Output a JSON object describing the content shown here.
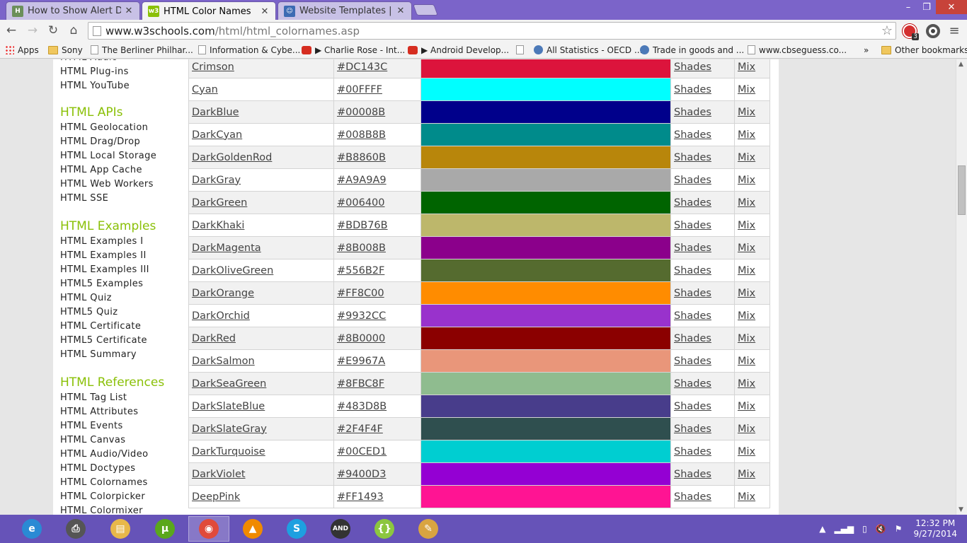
{
  "tabs": [
    {
      "title": "How to Show Alert Dialog",
      "icon": "hackernoon-icon",
      "active": false
    },
    {
      "title": "HTML Color Names",
      "icon": "w3schools-icon",
      "active": true
    },
    {
      "title": "Website Templates | Web",
      "icon": "templates-icon",
      "active": false
    }
  ],
  "window": {
    "minimize": "–",
    "maximize": "❐",
    "close": "✕"
  },
  "toolbar": {
    "url_host": "www.w3schools.com",
    "url_path": "/html/html_colornames.asp",
    "ext_badge": "3"
  },
  "bookmarks": [
    {
      "label": "Apps",
      "icon": "apps-icon"
    },
    {
      "label": "Sony",
      "icon": "folder-icon"
    },
    {
      "label": "The Berliner Philhar...",
      "icon": "page-icon"
    },
    {
      "label": "Information & Cybe...",
      "icon": "page-icon"
    },
    {
      "label": "▶ Charlie Rose - Int...",
      "icon": "youtube-icon"
    },
    {
      "label": "▶ Android Develop...",
      "icon": "youtube-icon"
    },
    {
      "label": "",
      "icon": "page-icon"
    },
    {
      "label": "All Statistics - OECD ...",
      "icon": "globe-icon"
    },
    {
      "label": "Trade in goods and ...",
      "icon": "globe-icon"
    },
    {
      "label": "www.cbseguess.co...",
      "icon": "page-icon"
    },
    {
      "label": "»",
      "icon": ""
    },
    {
      "label": "Other bookmarks",
      "icon": "folder-icon"
    }
  ],
  "sidebar": {
    "cut_top_item": "HTML Audio",
    "group0_items": [
      "HTML Plug-ins",
      "HTML YouTube"
    ],
    "groups": [
      {
        "heading": "HTML APIs",
        "items": [
          "HTML Geolocation",
          "HTML Drag/Drop",
          "HTML Local Storage",
          "HTML App Cache",
          "HTML Web Workers",
          "HTML SSE"
        ]
      },
      {
        "heading": "HTML Examples",
        "items": [
          "HTML Examples I",
          "HTML Examples II",
          "HTML Examples III",
          "HTML5 Examples",
          "HTML Quiz",
          "HTML5 Quiz",
          "HTML Certificate",
          "HTML5 Certificate",
          "HTML Summary"
        ]
      },
      {
        "heading": "HTML References",
        "items": [
          "HTML Tag List",
          "HTML Attributes",
          "HTML Events",
          "HTML Canvas",
          "HTML Audio/Video",
          "HTML Doctypes",
          "HTML Colornames",
          "HTML Colorpicker",
          "HTML Colormixer"
        ]
      }
    ]
  },
  "table": {
    "shades_label": "Shades",
    "mix_label": "Mix",
    "rows": [
      {
        "name": "Crimson",
        "hex": "#DC143C"
      },
      {
        "name": "Cyan",
        "hex": "#00FFFF"
      },
      {
        "name": "DarkBlue",
        "hex": "#00008B"
      },
      {
        "name": "DarkCyan",
        "hex": "#008B8B"
      },
      {
        "name": "DarkGoldenRod",
        "hex": "#B8860B"
      },
      {
        "name": "DarkGray",
        "hex": "#A9A9A9"
      },
      {
        "name": "DarkGreen",
        "hex": "#006400"
      },
      {
        "name": "DarkKhaki",
        "hex": "#BDB76B"
      },
      {
        "name": "DarkMagenta",
        "hex": "#8B008B"
      },
      {
        "name": "DarkOliveGreen",
        "hex": "#556B2F"
      },
      {
        "name": "DarkOrange",
        "hex": "#FF8C00"
      },
      {
        "name": "DarkOrchid",
        "hex": "#9932CC"
      },
      {
        "name": "DarkRed",
        "hex": "#8B0000"
      },
      {
        "name": "DarkSalmon",
        "hex": "#E9967A"
      },
      {
        "name": "DarkSeaGreen",
        "hex": "#8FBC8F"
      },
      {
        "name": "DarkSlateBlue",
        "hex": "#483D8B"
      },
      {
        "name": "DarkSlateGray",
        "hex": "#2F4F4F"
      },
      {
        "name": "DarkTurquoise",
        "hex": "#00CED1"
      },
      {
        "name": "DarkViolet",
        "hex": "#9400D3"
      },
      {
        "name": "DeepPink",
        "hex": "#FF1493"
      }
    ]
  },
  "taskbar": {
    "apps": [
      {
        "name": "internet-explorer-icon",
        "color": "#2a8ad4",
        "glyph": "e"
      },
      {
        "name": "printer-icon",
        "color": "#555555",
        "glyph": "⎙"
      },
      {
        "name": "file-explorer-icon",
        "color": "#e8b84a",
        "glyph": "▤"
      },
      {
        "name": "utorrent-icon",
        "color": "#5aa71c",
        "glyph": "µ"
      },
      {
        "name": "chrome-icon",
        "color": "#e04a3a",
        "glyph": "◉"
      },
      {
        "name": "vlc-icon",
        "color": "#f08a00",
        "glyph": "▲"
      },
      {
        "name": "skype-icon",
        "color": "#1ea0e0",
        "glyph": "S"
      },
      {
        "name": "android-studio-icon",
        "color": "#333333",
        "glyph": "AND"
      },
      {
        "name": "brackets-icon",
        "color": "#8cc63f",
        "glyph": "{}"
      },
      {
        "name": "paint-icon",
        "color": "#d9a441",
        "glyph": "✎"
      }
    ],
    "clock_time": "12:32 PM",
    "clock_date": "9/27/2014"
  },
  "colors": {
    "w3_green": "#8ac007",
    "taskbar": "#6653b8",
    "tabstrip": "#7b64c9"
  }
}
